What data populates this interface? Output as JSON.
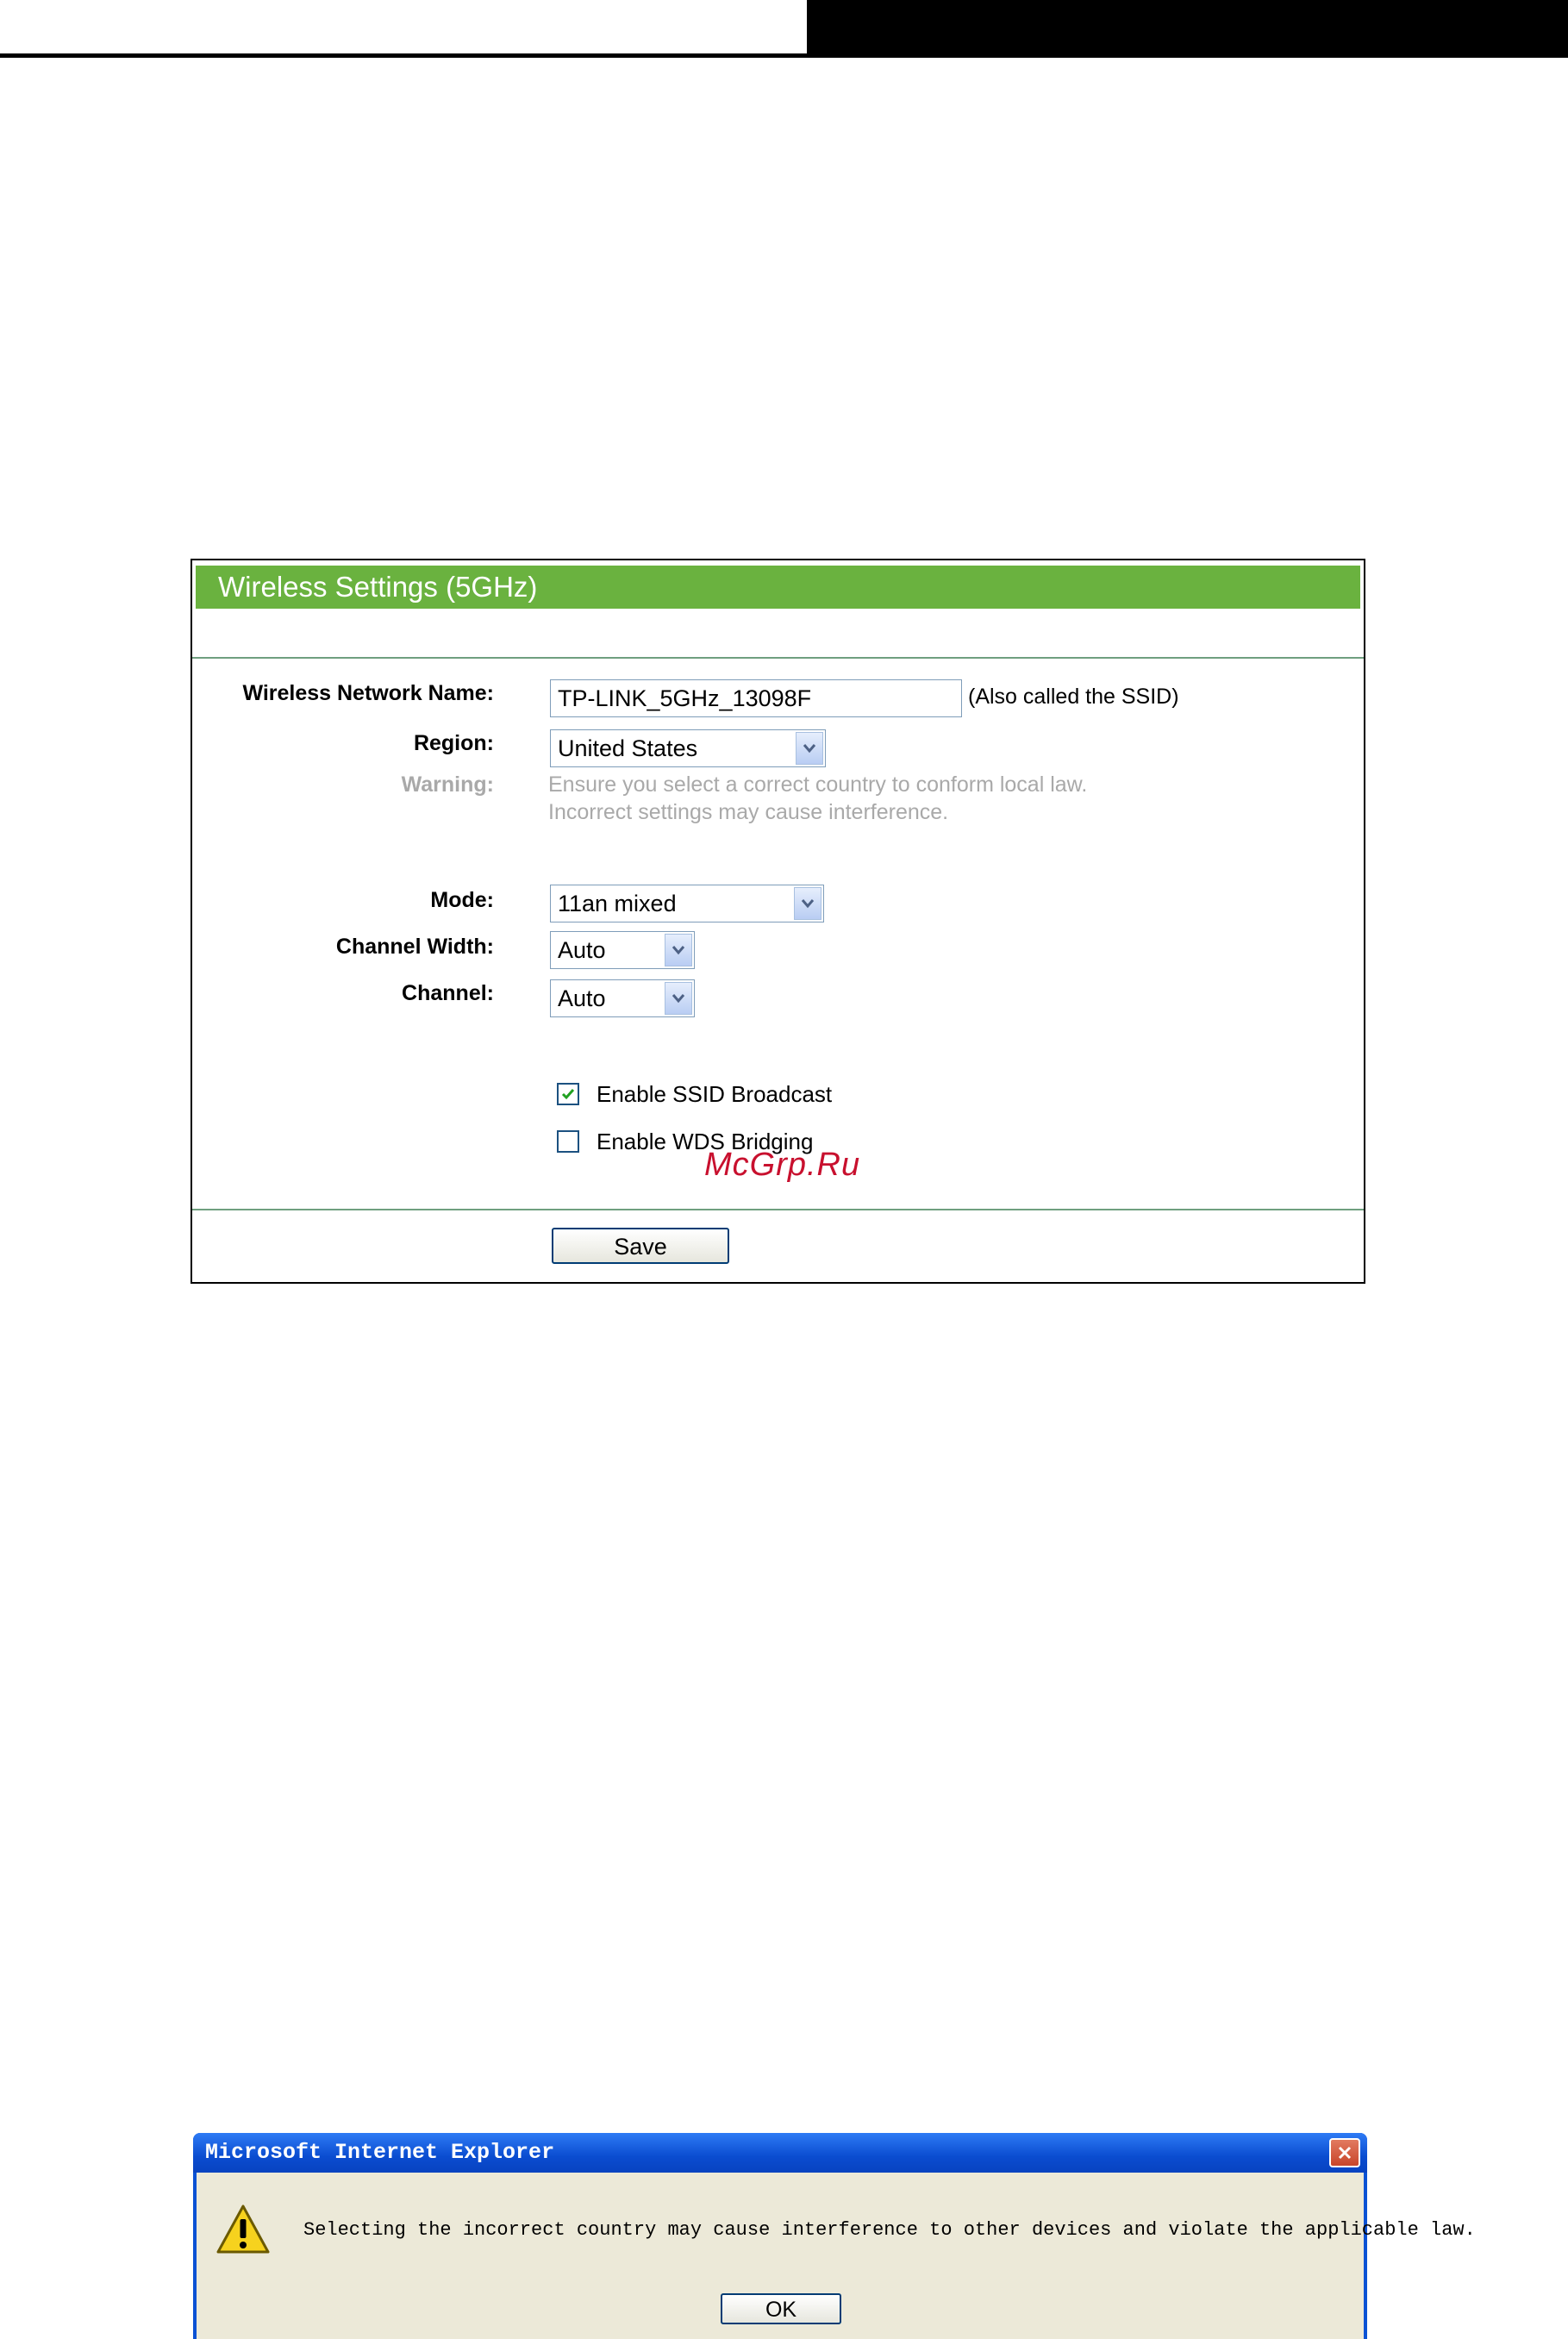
{
  "panel": {
    "title": "Wireless Settings (5GHz)",
    "network_name_label": "Wireless Network Name:",
    "network_name_value": "TP-LINK_5GHz_13098F",
    "network_name_hint": "(Also called the SSID)",
    "region_label": "Region:",
    "region_value": "United States",
    "warning_label": "Warning:",
    "warning_line1": "Ensure you select a correct country to conform local law.",
    "warning_line2": "Incorrect settings may cause interference.",
    "mode_label": "Mode:",
    "mode_value": "11an mixed",
    "channel_width_label": "Channel Width:",
    "channel_width_value": "Auto",
    "channel_label": "Channel:",
    "channel_value": "Auto",
    "ssid_broadcast_label": "Enable SSID Broadcast",
    "ssid_broadcast_checked": true,
    "wds_label": "Enable WDS Bridging",
    "wds_checked": false,
    "save_label": "Save"
  },
  "watermark": "McGrp.Ru",
  "dialog": {
    "title": "Microsoft Internet Explorer",
    "message": "Selecting the incorrect country may cause interference to other devices and violate the applicable law.",
    "ok_label": "OK"
  },
  "colors": {
    "title_bar": "#6ab23f",
    "divider": "#6f9f7f",
    "warning_text": "#a9a9a9",
    "watermark": "#c8102e",
    "dialog_titlebar": "#0a4cd0"
  },
  "icons": [
    "chevron-down-icon",
    "checkmark-icon",
    "warning-icon",
    "close-icon"
  ]
}
